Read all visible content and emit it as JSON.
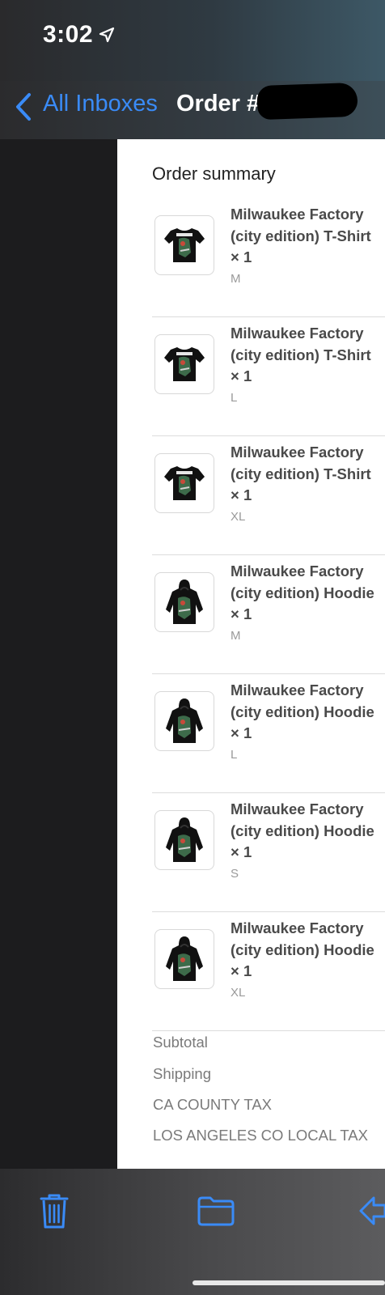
{
  "status_bar": {
    "time": "3:02"
  },
  "nav": {
    "back_label": "All Inboxes",
    "title": "Order #     1 c"
  },
  "content": {
    "section_title": "Order summary",
    "items": [
      {
        "name": "Milwaukee Factory (city edition) T-Shirt × 1",
        "variant": "M",
        "icon": "tshirt-icon"
      },
      {
        "name": "Milwaukee Factory (city edition) T-Shirt × 1",
        "variant": "L",
        "icon": "tshirt-icon"
      },
      {
        "name": "Milwaukee Factory (city edition) T-Shirt × 1",
        "variant": "XL",
        "icon": "tshirt-icon"
      },
      {
        "name": "Milwaukee Factory (city edition) Hoodie × 1",
        "variant": "M",
        "icon": "hoodie-icon"
      },
      {
        "name": "Milwaukee Factory (city edition) Hoodie × 1",
        "variant": "L",
        "icon": "hoodie-icon"
      },
      {
        "name": "Milwaukee Factory (city edition) Hoodie × 1",
        "variant": "S",
        "icon": "hoodie-icon"
      },
      {
        "name": "Milwaukee Factory (city edition) Hoodie × 1",
        "variant": "XL",
        "icon": "hoodie-icon"
      }
    ],
    "summary": {
      "subtotal_label": "Subtotal",
      "shipping_label": "Shipping",
      "county_tax_label": "CA COUNTY TAX",
      "local_tax_label": "LOS ANGELES CO LOCAL TAX"
    }
  },
  "toolbar": {
    "trash": "trash-icon",
    "folder": "folder-icon",
    "reply": "reply-icon"
  },
  "colors": {
    "accent": "#3a8bf7",
    "background": "#1c1c1e",
    "card": "#ffffff"
  }
}
